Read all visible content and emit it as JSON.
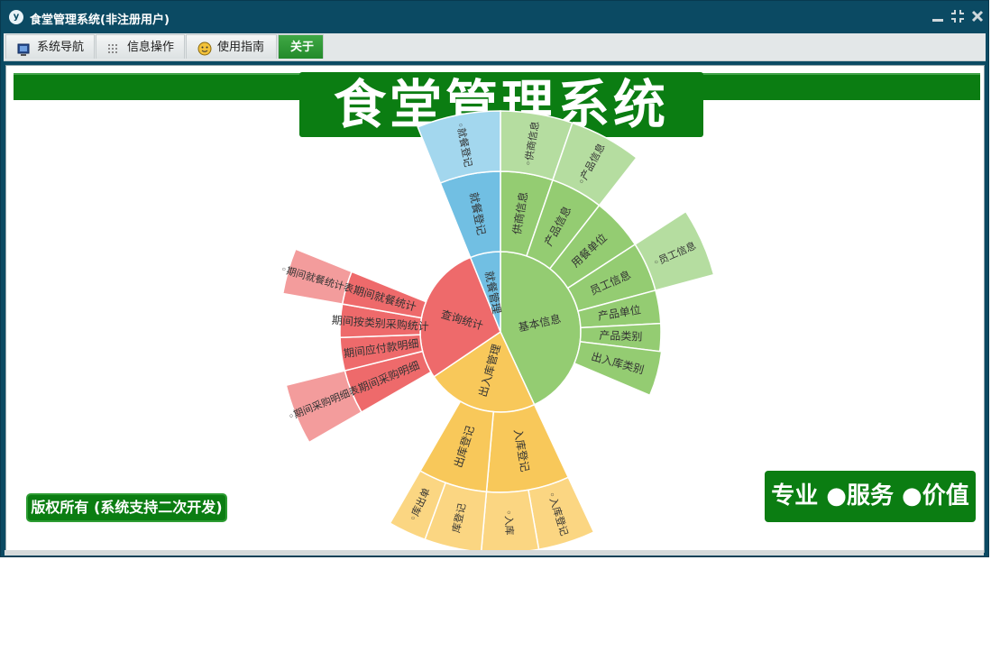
{
  "window": {
    "title": "食堂管理系统(非注册用户)",
    "app_icon_text": "y",
    "controls": [
      "minimize-icon",
      "restore-icon",
      "close-icon"
    ]
  },
  "menu": {
    "tabs": [
      {
        "label": "系统导航",
        "icon": "monitor-icon"
      },
      {
        "label": "信息操作",
        "icon": "grid-icon"
      },
      {
        "label": "使用指南",
        "icon": "smiley-icon"
      },
      {
        "label": "关于",
        "icon": ""
      }
    ],
    "active_tab": "关于"
  },
  "banner": {
    "title": "食堂管理系统"
  },
  "sunburst": {
    "colors": {
      "green": "#94cc72",
      "green_light": "#b5dda0",
      "blue": "#71bfe3",
      "blue_light": "#a3d7ee",
      "red": "#ee6a6b",
      "red_light": "#f39c9c",
      "orange": "#f8c85a",
      "orange_light": "#fbd682"
    },
    "inner": [
      {
        "label": "基本信息",
        "color": "green"
      },
      {
        "label": "出入库管理",
        "color": "orange"
      },
      {
        "label": "查询统计",
        "color": "red"
      },
      {
        "label": "就餐管理",
        "color": "blue"
      }
    ],
    "middle": [
      {
        "label": "供商信息",
        "parent": "基本信息"
      },
      {
        "label": "产品信息",
        "parent": "基本信息"
      },
      {
        "label": "用餐单位",
        "parent": "基本信息"
      },
      {
        "label": "员工信息",
        "parent": "基本信息"
      },
      {
        "label": "产品单位",
        "parent": "基本信息"
      },
      {
        "label": "产品类别",
        "parent": "基本信息"
      },
      {
        "label": "出入库类别",
        "parent": "基本信息"
      },
      {
        "label": "入库登记",
        "parent": "出入库管理"
      },
      {
        "label": "出库登记",
        "parent": "出入库管理"
      },
      {
        "label": "期间采购明细",
        "parent": "查询统计"
      },
      {
        "label": "期间应付款明细",
        "parent": "查询统计"
      },
      {
        "label": "期间按类别采购统计",
        "parent": "查询统计"
      },
      {
        "label": "期间就餐统计",
        "parent": "查询统计"
      },
      {
        "label": "就餐登记",
        "parent": "就餐管理"
      }
    ],
    "outer": [
      {
        "label": "◦供商信息",
        "parent": "供商信息"
      },
      {
        "label": "◦产品信息",
        "parent": "产品信息"
      },
      {
        "label": "◦员工信息",
        "parent": "员工信息"
      },
      {
        "label": "◦入库登记",
        "parent": "入库登记"
      },
      {
        "label": "◦入库",
        "parent": "入库登记"
      },
      {
        "label": "库登记",
        "parent": "出库登记"
      },
      {
        "label": "◦库出单",
        "parent": "出库登记"
      },
      {
        "label": "◦期间采购明细表",
        "parent": "期间采购明细"
      },
      {
        "label": "◦期间就餐统计表",
        "parent": "期间就餐统计"
      },
      {
        "label": "◦就餐登记",
        "parent": "就餐登记"
      }
    ]
  },
  "footer": {
    "copyright": "版权所有 (系统支持二次开发)",
    "slogan": "专业 ●服务 ●价值"
  }
}
